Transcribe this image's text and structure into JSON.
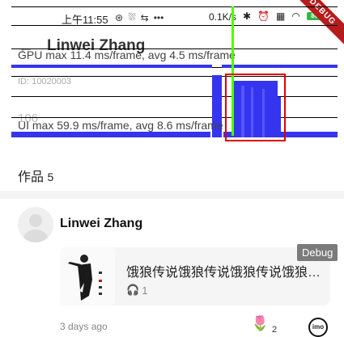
{
  "status_bar": {
    "time": "上午11:55",
    "speed": "0.1K/s",
    "battery": "80",
    "icons": [
      "notification-icon",
      "app-icon",
      "translate-icon",
      "more-dots-icon",
      "bluetooth-icon",
      "alarm-icon",
      "no-sim-icon",
      "wifi-icon",
      "battery-icon"
    ]
  },
  "debug_banner": "DEBUG",
  "header": {
    "back": "←",
    "name": "Linwei Zhang",
    "id_text": "ID: 10020003",
    "stat_text": "106"
  },
  "perf_overlay": {
    "gpu_label": "GPU  max 11.4  ms/frame, avg 4.5  ms/frame",
    "ui_label": "UI  max 59.9 ms/frame, avg 8.6 ms/frame",
    "colors": {
      "bars": "#3535f0",
      "marker": "#4cff00",
      "highlight": "#e00000"
    }
  },
  "works": {
    "label": "作品",
    "count": "5"
  },
  "post": {
    "author": "Linwei Zhang",
    "card_title": "饿狼传说饿狼传说饿狼传说饿狼传说",
    "plays": "1",
    "time_ago": "3 days ago",
    "flower_count": "2",
    "imo_label": "imo"
  },
  "debug_tag": "Debug"
}
